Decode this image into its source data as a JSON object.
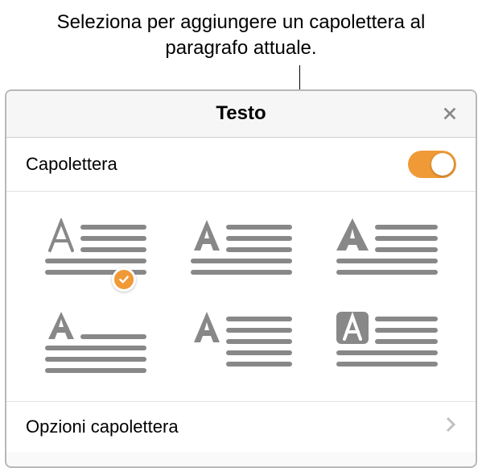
{
  "annotation": {
    "text": "Seleziona per aggiungere un capolettera al paragrafo attuale."
  },
  "panel": {
    "title": "Testo"
  },
  "dropCap": {
    "label": "Capolettera",
    "enabled": true,
    "selectedStyle": 0,
    "styles": [
      {
        "name": "drop-cap-style-1"
      },
      {
        "name": "drop-cap-style-2"
      },
      {
        "name": "drop-cap-style-3"
      },
      {
        "name": "drop-cap-style-4"
      },
      {
        "name": "drop-cap-style-5"
      },
      {
        "name": "drop-cap-style-6"
      }
    ]
  },
  "options": {
    "label": "Opzioni capolettera"
  },
  "colors": {
    "accent": "#f09a37",
    "line": "#888888"
  }
}
